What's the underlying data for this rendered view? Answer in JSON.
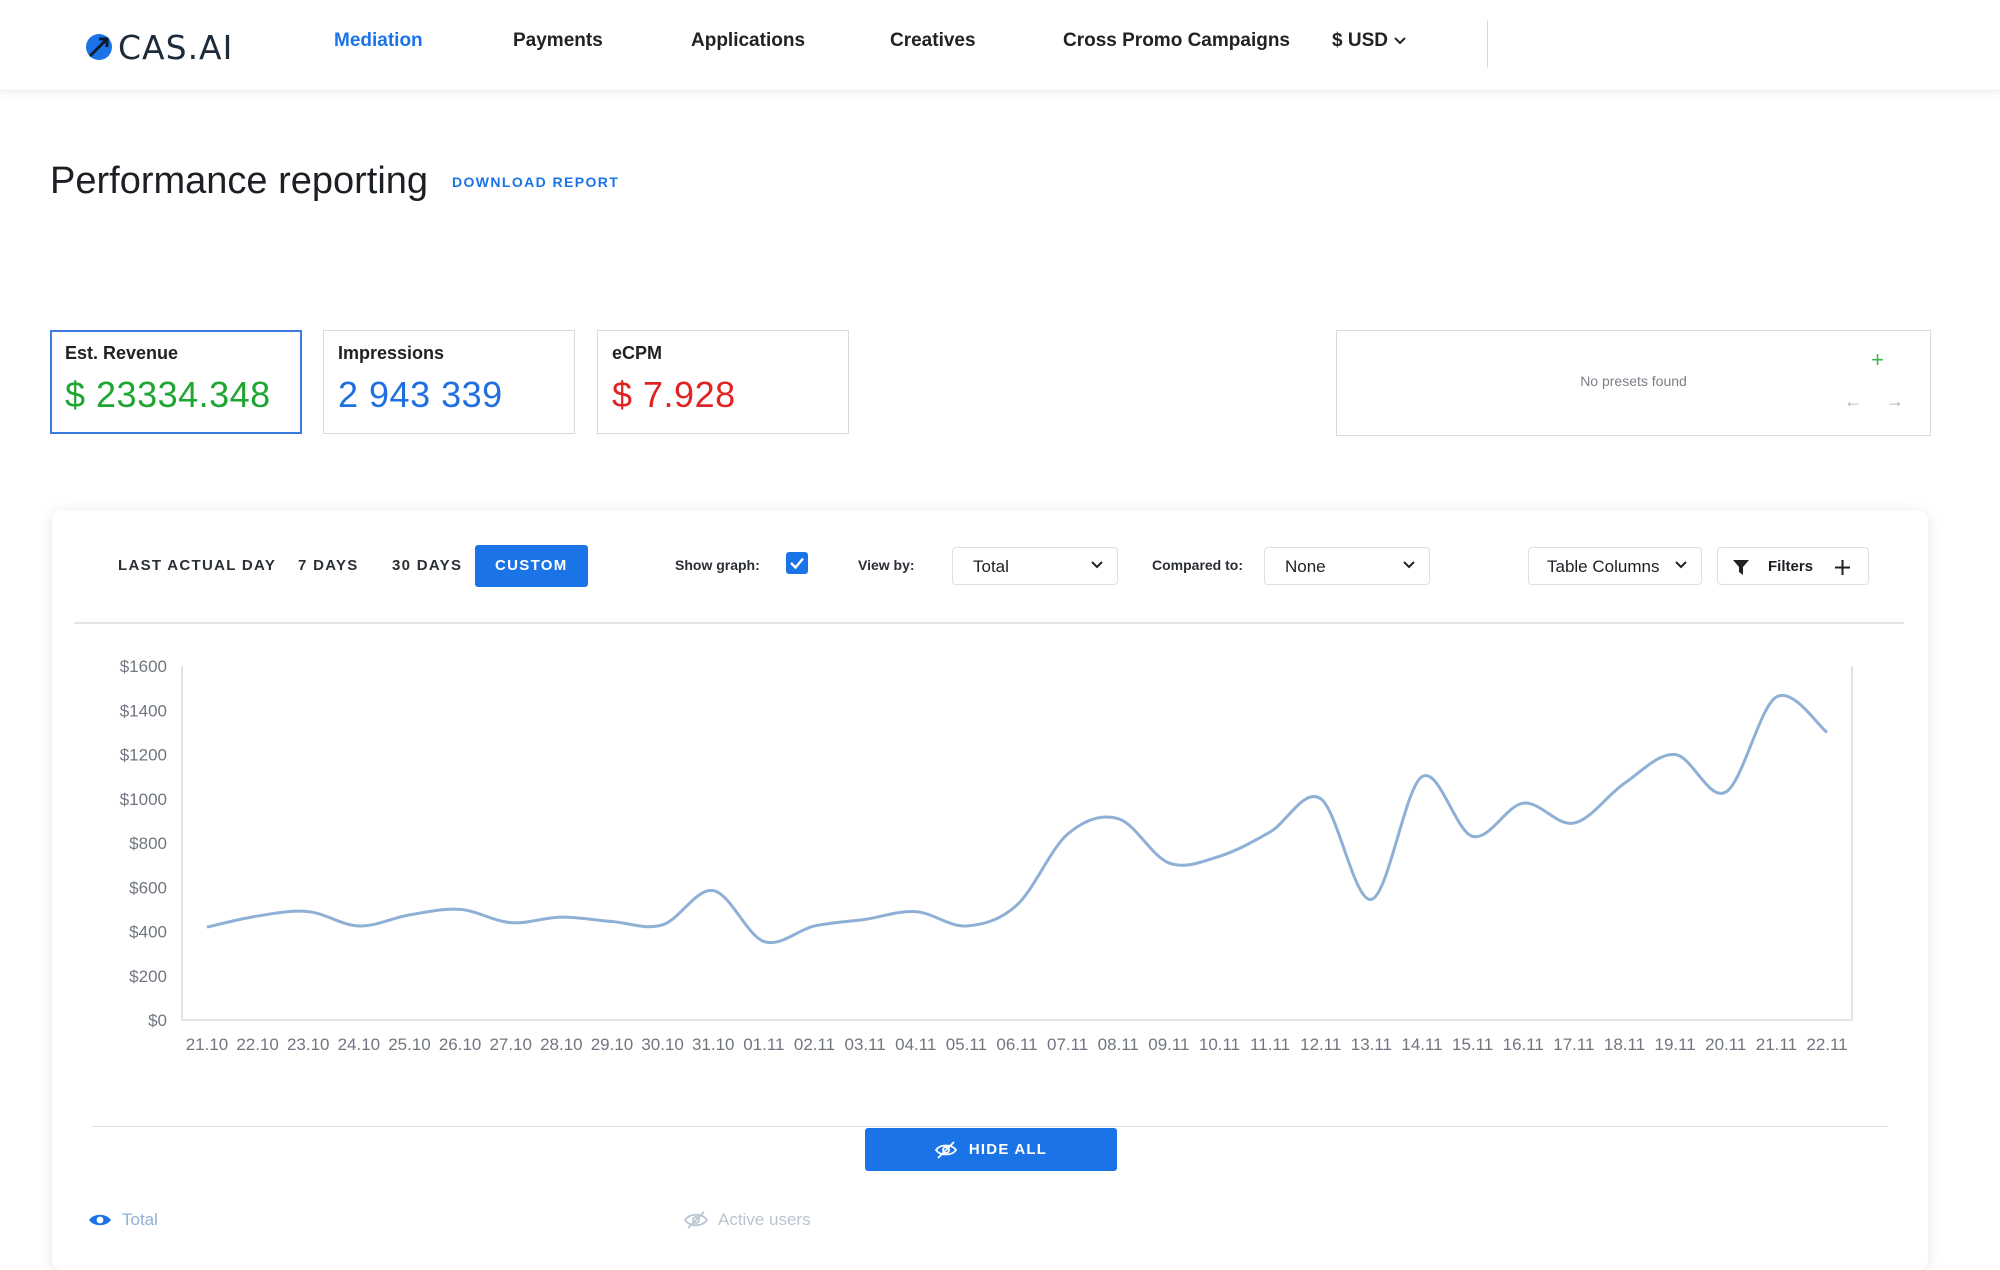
{
  "brand": {
    "name": "CAS.AI"
  },
  "nav": {
    "items": [
      {
        "label": "Mediation",
        "active": true
      },
      {
        "label": "Payments",
        "active": false
      },
      {
        "label": "Applications",
        "active": false
      },
      {
        "label": "Creatives",
        "active": false
      },
      {
        "label": "Cross Promo Campaigns",
        "active": false
      }
    ],
    "currency": "$ USD"
  },
  "header": {
    "title": "Performance reporting",
    "download_label": "DOWNLOAD REPORT"
  },
  "kpis": [
    {
      "label": "Est. Revenue",
      "value": "$ 23334.348",
      "color": "#1fa531",
      "selected": true
    },
    {
      "label": "Impressions",
      "value": "2 943 339",
      "color": "#1f6fe0",
      "selected": false
    },
    {
      "label": "eCPM",
      "value": "$ 7.928",
      "color": "#e02424",
      "selected": false
    }
  ],
  "presets": {
    "empty_text": "No presets found",
    "add_icon": "plus-icon"
  },
  "report": {
    "ranges": [
      {
        "label": "LAST ACTUAL DAY",
        "active": false
      },
      {
        "label": "7 DAYS",
        "active": false
      },
      {
        "label": "30 DAYS",
        "active": false
      },
      {
        "label": "CUSTOM",
        "active": true
      }
    ],
    "show_graph_label": "Show graph:",
    "show_graph_checked": true,
    "view_by_label": "View by:",
    "view_by_value": "Total",
    "compared_to_label": "Compared to:",
    "compared_to_value": "None",
    "table_columns_label": "Table Columns",
    "filters_label": "Filters",
    "hide_all_label": "HIDE ALL",
    "legend": [
      {
        "label": "Total",
        "visible": true,
        "color": "#8fb0d6"
      },
      {
        "label": "Active users",
        "visible": false,
        "color": "#b9c4d1"
      }
    ]
  },
  "chart_data": {
    "type": "line",
    "x": [
      "21.10",
      "22.10",
      "23.10",
      "24.10",
      "25.10",
      "26.10",
      "27.10",
      "28.10",
      "29.10",
      "30.10",
      "31.10",
      "01.11",
      "02.11",
      "03.11",
      "04.11",
      "05.11",
      "06.11",
      "07.11",
      "08.11",
      "09.11",
      "10.11",
      "11.11",
      "12.11",
      "13.11",
      "14.11",
      "15.11",
      "16.11",
      "17.11",
      "18.11",
      "19.11",
      "20.11",
      "21.11",
      "22.11"
    ],
    "series": [
      {
        "values": [
          420,
          470,
          490,
          425,
          475,
          500,
          440,
          465,
          445,
          430,
          585,
          355,
          425,
          455,
          490,
          425,
          520,
          840,
          910,
          710,
          740,
          850,
          1000,
          545,
          1100,
          830,
          980,
          890,
          1070,
          1200,
          1030,
          1460,
          1300
        ],
        "color": "#8fb0d6"
      }
    ],
    "y_ticks": [
      "$0",
      "$200",
      "$400",
      "$600",
      "$800",
      "$1000",
      "$1200",
      "$1400",
      "$1600"
    ],
    "ylim": [
      0,
      1600
    ],
    "grid": false
  }
}
